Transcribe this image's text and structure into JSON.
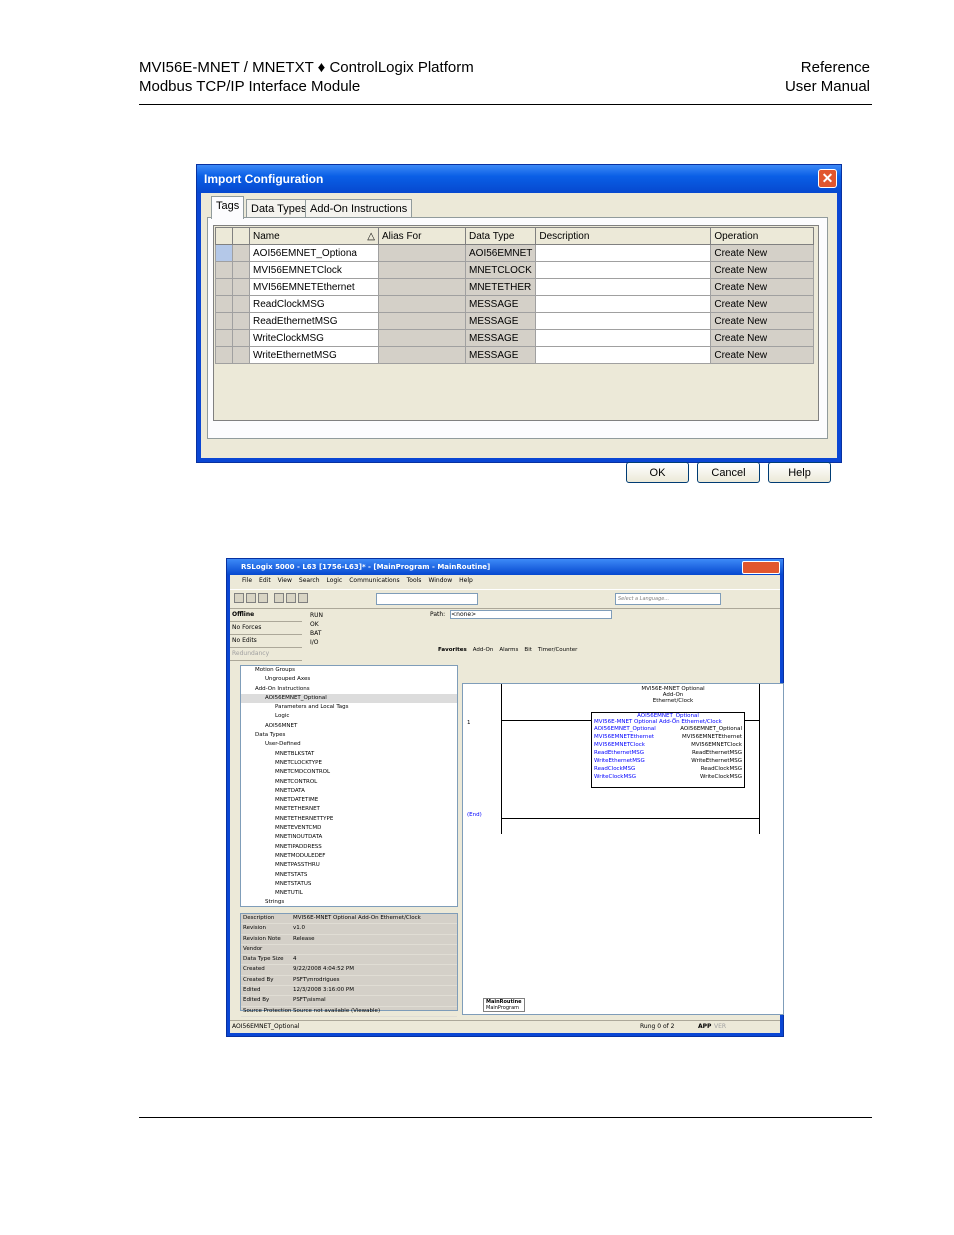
{
  "header": {
    "left_line1": "MVI56E-MNET / MNETXT ♦ ControlLogix Platform",
    "left_line2": "Modbus TCP/IP Interface Module",
    "right_line1": "Reference",
    "right_line2": "User Manual"
  },
  "dialog": {
    "title": "Import Configuration",
    "close_glyph": "✕",
    "tabs": [
      "Tags",
      "Data Types",
      "Add-On Instructions"
    ],
    "columns": [
      "Name",
      "Alias For",
      "Data Type",
      "Description",
      "Operation"
    ],
    "sort_glyph": "△",
    "rows": [
      {
        "name": "AOI56EMNET_Optiona",
        "alias": "",
        "type": "AOI56EMNET",
        "desc": "",
        "op": "Create New"
      },
      {
        "name": "MVI56EMNETClock",
        "alias": "",
        "type": "MNETCLOCK",
        "desc": "",
        "op": "Create New"
      },
      {
        "name": "MVI56EMNETEthernet",
        "alias": "",
        "type": "MNETETHER",
        "desc": "",
        "op": "Create New"
      },
      {
        "name": "ReadClockMSG",
        "alias": "",
        "type": "MESSAGE",
        "desc": "",
        "op": "Create New"
      },
      {
        "name": "ReadEthernetMSG",
        "alias": "",
        "type": "MESSAGE",
        "desc": "",
        "op": "Create New"
      },
      {
        "name": "WriteClockMSG",
        "alias": "",
        "type": "MESSAGE",
        "desc": "",
        "op": "Create New"
      },
      {
        "name": "WriteEthernetMSG",
        "alias": "",
        "type": "MESSAGE",
        "desc": "",
        "op": "Create New"
      }
    ],
    "buttons": {
      "ok": "OK",
      "cancel": "Cancel",
      "help": "Help"
    }
  },
  "rslogix": {
    "title": "RSLogix 5000 - L63 [1756-L63]* - [MainProgram - MainRoutine]",
    "menu": [
      "File",
      "Edit",
      "View",
      "Search",
      "Logic",
      "Communications",
      "Tools",
      "Window",
      "Help"
    ],
    "language_placeholder": "Select a Language...",
    "path_label": "Path:",
    "path_value": "<none>",
    "status": [
      "Offline",
      "No Forces",
      "No Edits",
      "Redundancy"
    ],
    "indicators": [
      "RUN",
      "OK",
      "BAT",
      "I/O"
    ],
    "instruction_tabs": [
      "Favorites",
      "Add-On",
      "Alarms",
      "Bit",
      "Timer/Counter"
    ],
    "tree": [
      {
        "label": "Motion Groups",
        "indent": 1
      },
      {
        "label": "Ungrouped Axes",
        "indent": 2
      },
      {
        "label": "Add-On Instructions",
        "indent": 1
      },
      {
        "label": "AOI56EMNET_Optional",
        "indent": 2
      },
      {
        "label": "Parameters and Local Tags",
        "indent": 3
      },
      {
        "label": "Logic",
        "indent": 3
      },
      {
        "label": "AOI56MNET",
        "indent": 2
      },
      {
        "label": "Data Types",
        "indent": 1
      },
      {
        "label": "User-Defined",
        "indent": 2
      },
      {
        "label": "MNETBLKSTAT",
        "indent": 3
      },
      {
        "label": "MNETCLOCKTYPE",
        "indent": 3
      },
      {
        "label": "MNETCMDCONTROL",
        "indent": 3
      },
      {
        "label": "MNETCONTROL",
        "indent": 3
      },
      {
        "label": "MNETDATA",
        "indent": 3
      },
      {
        "label": "MNETDATETIME",
        "indent": 3
      },
      {
        "label": "MNETETHERNET",
        "indent": 3
      },
      {
        "label": "MNETETHERNETTYPE",
        "indent": 3
      },
      {
        "label": "MNETEVENTCMD",
        "indent": 3
      },
      {
        "label": "MNETINOUTDATA",
        "indent": 3
      },
      {
        "label": "MNETIPADDRESS",
        "indent": 3
      },
      {
        "label": "MNETMODULEDEF",
        "indent": 3
      },
      {
        "label": "MNETPASSTHRU",
        "indent": 3
      },
      {
        "label": "MNETSTATS",
        "indent": 3
      },
      {
        "label": "MNETSTATUS",
        "indent": 3
      },
      {
        "label": "MNETUTIL",
        "indent": 3
      },
      {
        "label": "Strings",
        "indent": 2
      }
    ],
    "props": [
      {
        "k": "Description",
        "v": "MVI56E-MNET Optional Add-On Ethernet/Clock"
      },
      {
        "k": "Revision",
        "v": "v1.0"
      },
      {
        "k": "Revision Note",
        "v": "Release"
      },
      {
        "k": "Vendor",
        "v": ""
      },
      {
        "k": "Data Type Size",
        "v": "4"
      },
      {
        "k": "Created",
        "v": "9/22/2008 4:04:52 PM"
      },
      {
        "k": "Created By",
        "v": "PSFT\\mrodrigues"
      },
      {
        "k": "Edited",
        "v": "12/3/2008 3:16:00 PM"
      },
      {
        "k": "Edited By",
        "v": "PSFT\\sismal"
      },
      {
        "k": "Source Protection",
        "v": "Source not available (Viewable)"
      }
    ],
    "ladder": {
      "header": [
        "MVI56E-MNET Optional",
        "Add-On",
        "Ethernet/Clock"
      ],
      "rung_no": "1",
      "end_label": "(End)",
      "block_title": "AOI56EMNET_Optional",
      "block_desc": "MVI56E-MNET Optional Add-On Ethernet/Clock",
      "params": [
        {
          "l": "AOI56EMNET_Optional",
          "r": "AOI56EMNET_Optional"
        },
        {
          "l": "MVI56EMNETEthernet",
          "r": "MVI56EMNETEthernet"
        },
        {
          "l": "MVI56EMNETClock",
          "r": "MVI56EMNETClock"
        },
        {
          "l": "ReadEthernetMSG",
          "r": "ReadEthernetMSG"
        },
        {
          "l": "WriteEthernetMSG",
          "r": "WriteEthernetMSG"
        },
        {
          "l": "ReadClockMSG",
          "r": "ReadClockMSG"
        },
        {
          "l": "WriteClockMSG",
          "r": "WriteClockMSG"
        }
      ],
      "sheet_tab": "MainRoutine",
      "sheet_sub": "MainProgram"
    },
    "statusbar_left": "AOI56EMNET_Optional",
    "statusbar_rung": "Rung 0 of 2",
    "statusbar_app": "APP",
    "statusbar_ver": "VER"
  }
}
